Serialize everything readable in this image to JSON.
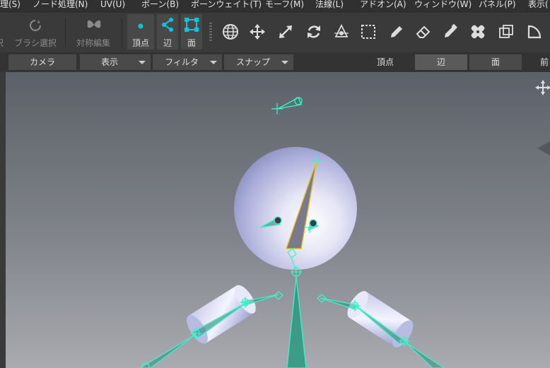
{
  "menu": {
    "items": [
      "理(S)",
      "ノード処理(N)",
      "UV(U)",
      "ボーン(B)",
      "ボーンウェイト(T)",
      "モーフ(M)",
      "法線(L)",
      "アドオン(A)",
      "ウィンドウ(W)",
      "パネル(P)",
      "表示("
    ]
  },
  "toolbar": {
    "brush_select_label": "ブラシ選択",
    "symmetry_edit_label": "対称編集",
    "vertex_label": "頂点",
    "edge_label": "辺",
    "face_label": "面",
    "icons": [
      "globe-icon",
      "move-icon",
      "scale-icon",
      "rotate-icon",
      "pivot-icon",
      "rect-select-icon",
      "pen-icon",
      "eraser-icon",
      "paint-icon",
      "bandage-icon",
      "cube-icon",
      "shape-icon"
    ]
  },
  "subbar": {
    "camera_label": "カメラ",
    "display_label": "表示",
    "filter_label": "フィルタ",
    "snap_label": "スナップ",
    "vertex_label": "頂点",
    "edge_label": "辺",
    "face_label": "面",
    "front_label": "前"
  },
  "colors": {
    "accent": "#00c8e0",
    "bone": "#3ff0c8",
    "selected_bone": "#e8c020"
  }
}
